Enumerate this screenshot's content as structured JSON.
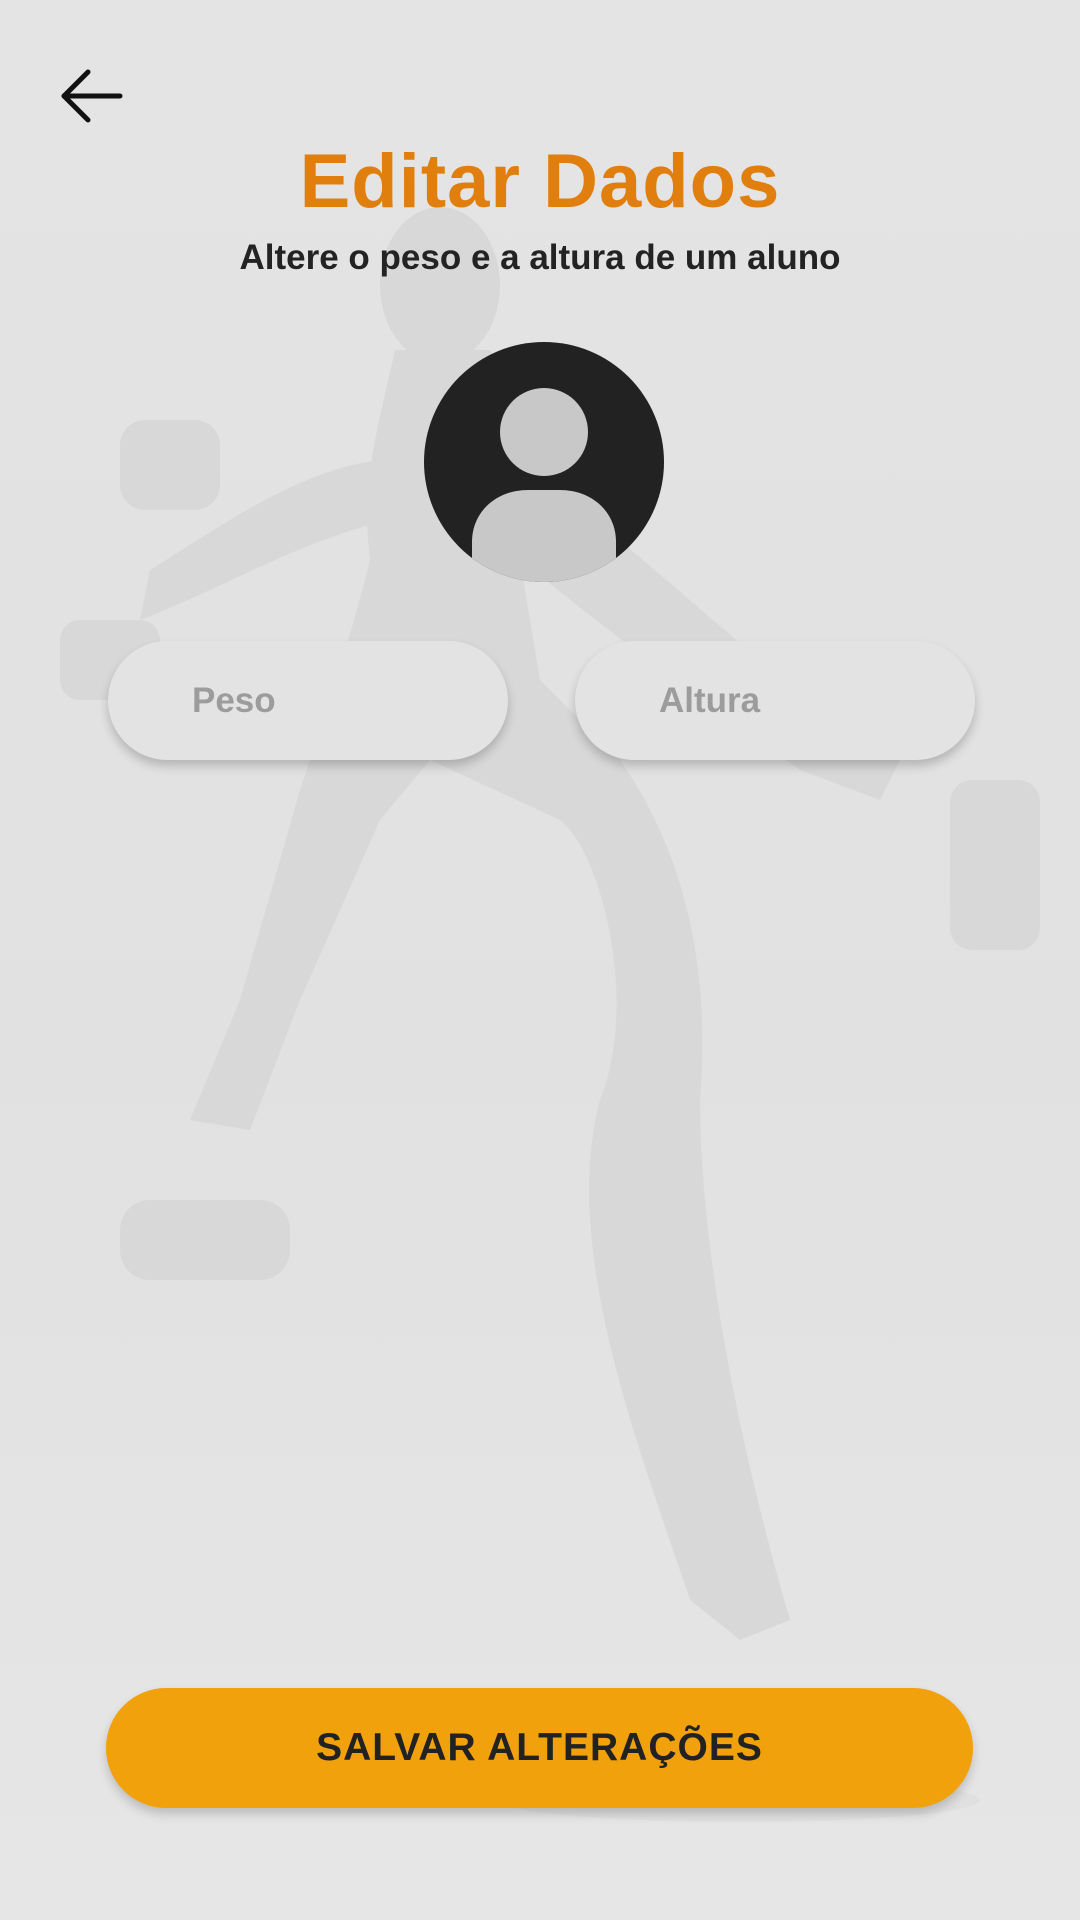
{
  "header": {
    "back_icon": "arrow-left-icon",
    "title": "Editar Dados",
    "subtitle": "Altere o peso e a altura de um aluno"
  },
  "avatar": {
    "icon": "user-silhouette-icon"
  },
  "form": {
    "peso": {
      "value": "",
      "placeholder": "Peso"
    },
    "altura": {
      "value": "",
      "placeholder": "Altura"
    }
  },
  "actions": {
    "save_label": "SALVAR ALTERAÇÕES"
  },
  "colors": {
    "accent_title": "#e07f0e",
    "button": "#f0a10c",
    "background": "#e3e3e3",
    "avatar": "#222222"
  }
}
